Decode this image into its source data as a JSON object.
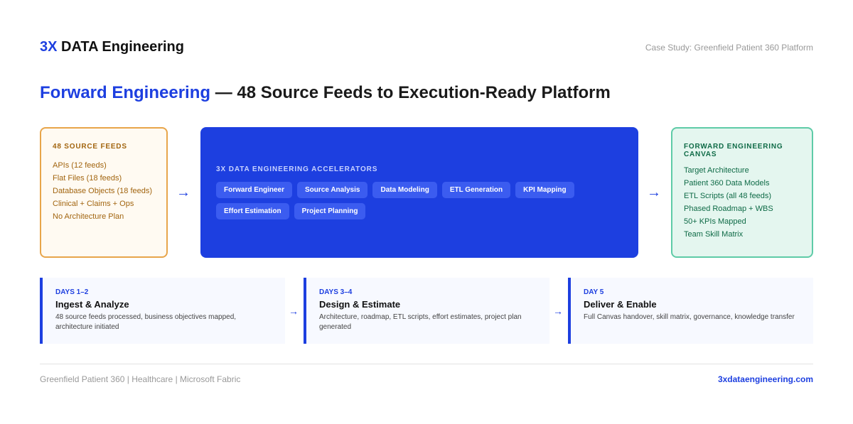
{
  "header": {
    "brand_accent": "3X",
    "brand_rest": "DATA Engineering",
    "case_study": "Case Study: Greenfield Patient 360 Platform"
  },
  "title": {
    "highlight": "Forward Engineering",
    "rest": " — 48 Source Feeds to Execution-Ready Platform"
  },
  "source_feeds": {
    "heading": "48 SOURCE FEEDS",
    "items": [
      "APIs (12 feeds)",
      "Flat Files (18 feeds)",
      "Database Objects (18 feeds)",
      "Clinical + Claims + Ops",
      "No Architecture Plan"
    ]
  },
  "accelerators": {
    "heading": "3X DATA ENGINEERING ACCELERATORS",
    "chips": [
      "Forward Engineer",
      "Source Analysis",
      "Data Modeling",
      "ETL Generation",
      "KPI Mapping",
      "Effort Estimation",
      "Project Planning"
    ]
  },
  "canvas": {
    "heading": "FORWARD ENGINEERING CANVAS",
    "items": [
      "Target Architecture",
      "Patient 360 Data Models",
      "ETL Scripts (all 48 feeds)",
      "Phased Roadmap + WBS",
      "50+ KPIs Mapped",
      "Team Skill Matrix"
    ]
  },
  "arrow_glyph": "→",
  "phases": [
    {
      "days": "DAYS 1–2",
      "name": "Ingest & Analyze",
      "desc": "48 source feeds processed, business objectives mapped, architecture initiated"
    },
    {
      "days": "DAYS 3–4",
      "name": "Design & Estimate",
      "desc": "Architecture, roadmap, ETL scripts, effort estimates, project plan generated"
    },
    {
      "days": "DAY 5",
      "name": "Deliver & Enable",
      "desc": "Full Canvas handover, skill matrix, governance, knowledge transfer"
    }
  ],
  "footer": {
    "left": "Greenfield Patient 360 | Healthcare | Microsoft Fabric",
    "right": "3xdataengineering.com"
  },
  "colors": {
    "accent": "#1d3fe0",
    "source_border": "#e8a54a",
    "canvas_border": "#5ecba7"
  }
}
